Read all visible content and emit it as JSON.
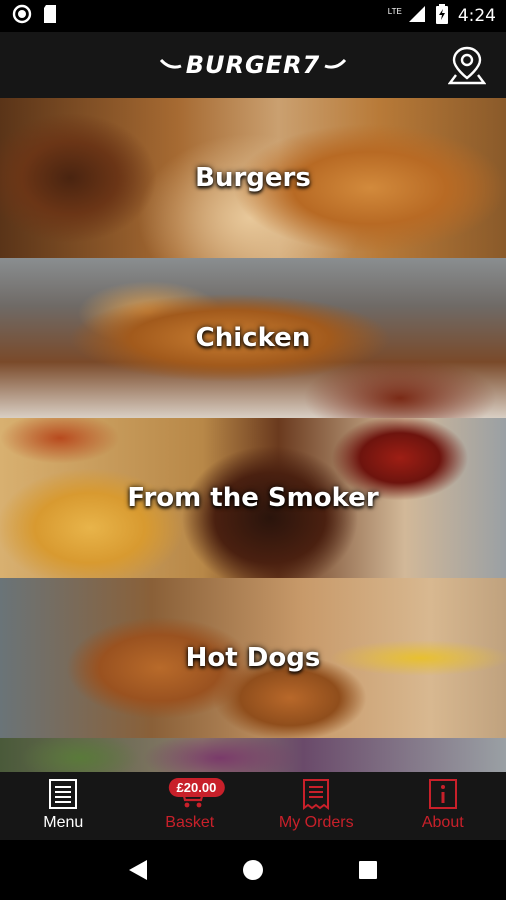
{
  "status_bar": {
    "time": "4:24",
    "network": "LTE"
  },
  "header": {
    "brand": "BURGER7",
    "location_icon": "map-pin-icon"
  },
  "categories": [
    {
      "label": "Burgers"
    },
    {
      "label": "Chicken"
    },
    {
      "label": "From the Smoker"
    },
    {
      "label": "Hot Dogs"
    },
    {
      "label": ""
    }
  ],
  "bottom_nav": {
    "menu_label": "Menu",
    "basket_label": "Basket",
    "basket_badge": "£20.00",
    "orders_label": "My Orders",
    "about_label": "About"
  },
  "colors": {
    "accent": "#c8202a",
    "header_bg": "#161616"
  }
}
